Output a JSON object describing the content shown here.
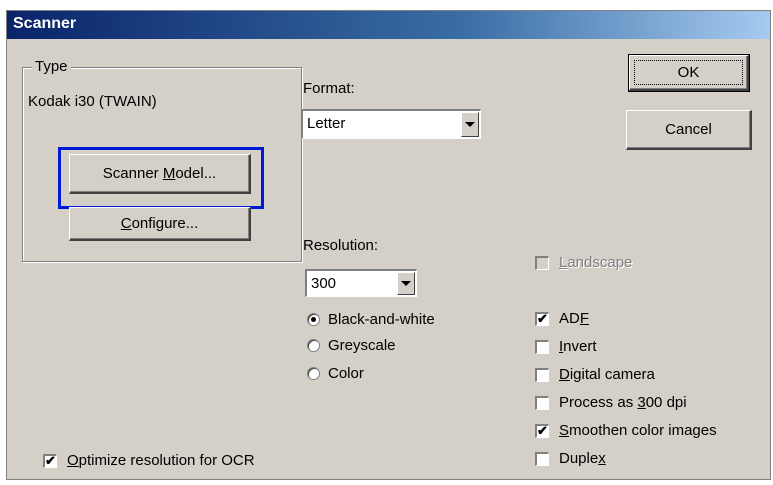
{
  "window": {
    "title": "Scanner"
  },
  "type_group": {
    "label": "Type",
    "device": "Kodak i30 (TWAIN)",
    "scanner_model": {
      "pre": "Scanner ",
      "mn": "M",
      "post": "odel..."
    },
    "configure": {
      "pre": "",
      "mn": "C",
      "post": "onfigure..."
    }
  },
  "format": {
    "label": "Format:",
    "value": "Letter"
  },
  "resolution": {
    "label": "Resolution:",
    "value": "300"
  },
  "color_modes": [
    {
      "label": "Black-and-white",
      "selected": true
    },
    {
      "label": "Greyscale",
      "selected": false
    },
    {
      "label": "Color",
      "selected": false
    }
  ],
  "buttons": {
    "ok": "OK",
    "cancel": "Cancel"
  },
  "landscape": {
    "pre": "",
    "mn": "L",
    "post": "andscape",
    "checked": false,
    "enabled": false
  },
  "options": [
    {
      "pre": "AD",
      "mn": "F",
      "post": "",
      "checked": true
    },
    {
      "pre": "",
      "mn": "I",
      "post": "nvert",
      "checked": false
    },
    {
      "pre": "",
      "mn": "D",
      "post": "igital camera",
      "checked": false
    },
    {
      "pre": "Process as ",
      "mn": "3",
      "post": "00 dpi",
      "checked": false
    },
    {
      "pre": "",
      "mn": "S",
      "post": "moothen color images",
      "checked": true
    },
    {
      "pre": "Duple",
      "mn": "x",
      "post": "",
      "checked": false
    }
  ],
  "optimize_ocr": {
    "pre": "",
    "mn": "O",
    "post": "ptimize resolution for OCR",
    "checked": true
  },
  "colors": {
    "title_start": "#0a246a",
    "title_end": "#a6caf0",
    "highlight": "#0018d8",
    "face": "#d4d0c8"
  },
  "check_mark": "✔"
}
